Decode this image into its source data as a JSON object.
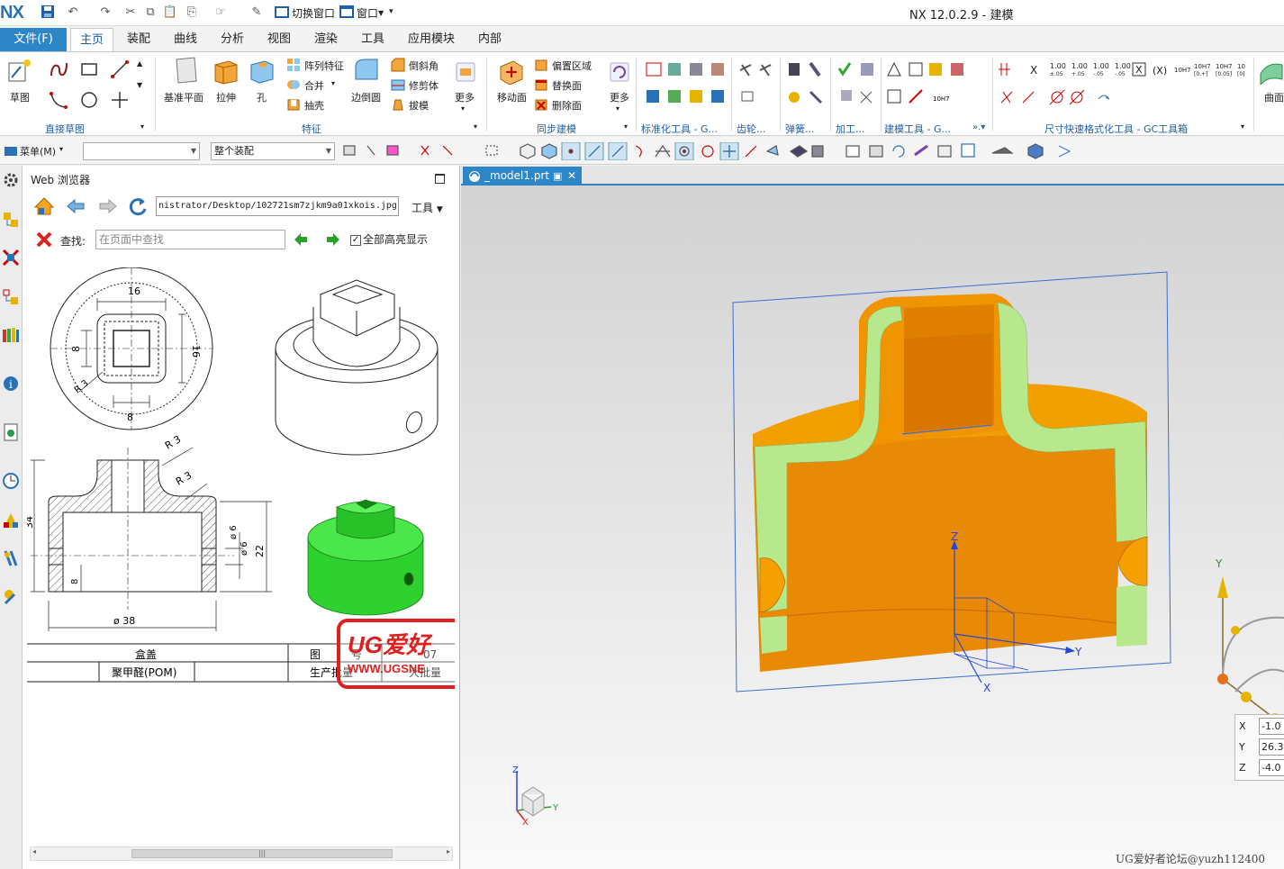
{
  "app": {
    "logo": "NX",
    "window_title": "NX 12.0.2.9 - 建模",
    "quick_access": {
      "switch_window": "切换窗口",
      "window": "窗口"
    }
  },
  "tabs": {
    "file": "文件(F)",
    "items": [
      "主页",
      "装配",
      "曲线",
      "分析",
      "视图",
      "渲染",
      "工具",
      "应用模块",
      "内部"
    ],
    "active": "主页"
  },
  "ribbon": {
    "sketch": {
      "label": "草图",
      "group": "直接草图"
    },
    "feature": {
      "datum_plane": "基准平面",
      "extrude": "拉伸",
      "hole": "孔",
      "pattern": "阵列特征",
      "unite": "合并",
      "shell": "抽壳",
      "edge_blend": "边倒圆",
      "chamfer": "倒斜角",
      "trim": "修剪体",
      "draft": "拔模",
      "more": "更多",
      "group": "特征"
    },
    "sync": {
      "move_face": "移动面",
      "offset_region": "偏置区域",
      "replace_face": "替换面",
      "delete_face": "删除面",
      "more": "更多",
      "group": "同步建模"
    },
    "groups_right": [
      "标准化工具 - G...",
      "齿轮...",
      "弹簧...",
      "加工...",
      "建模工具 - G...",
      "尺寸快速格式化工具 - GC工具箱"
    ],
    "curve_label": "曲面",
    "tol_labels": [
      "1.00",
      "1.00",
      "1.00",
      "1.00",
      "10H7",
      "10H7",
      "10H7"
    ]
  },
  "toolbar2": {
    "menu": "菜单(M)",
    "filter": "",
    "assembly_scope": "整个装配"
  },
  "web_browser": {
    "title": "Web 浏览器",
    "url": "nistrator/Desktop/102721sm7zjkm9a01xkois.jpg",
    "tools": "工具",
    "find_label": "查找:",
    "find_placeholder": "在页面中查找",
    "highlight_all": "全部高亮显示"
  },
  "drawing": {
    "dims_top": [
      "16",
      "16",
      "8",
      "8",
      "R 3"
    ],
    "dims_section": [
      "R 3",
      "R 3",
      "34",
      "ø 6",
      "ø 6",
      "22",
      "8",
      "ø 38"
    ],
    "title_block": {
      "name": "盒盖",
      "drawing_no_label": "图",
      "drawing_no_suffix": "号",
      "drawing_no": "07",
      "material": "聚甲醛(POM)",
      "production_label": "生产批量",
      "production_value": "大批量"
    },
    "stamp_text": "UG爱好",
    "stamp_url": "WWW.UGSNE"
  },
  "graphics": {
    "tab": "_model1.prt",
    "coords": {
      "x_label": "X",
      "y_label": "Y",
      "z_label": "Z",
      "x": "-1.0",
      "y": "26.3",
      "z": "-4.0"
    },
    "triad_labels": {
      "x": "X",
      "y": "Y",
      "z": "Z"
    },
    "watermark": "UG爱好者论坛@yuzh112400"
  },
  "colors": {
    "accent": "#2d86c7",
    "part_orange": "#e8900a",
    "section_green": "#b7e88c",
    "model_green": "#2ed12e"
  }
}
